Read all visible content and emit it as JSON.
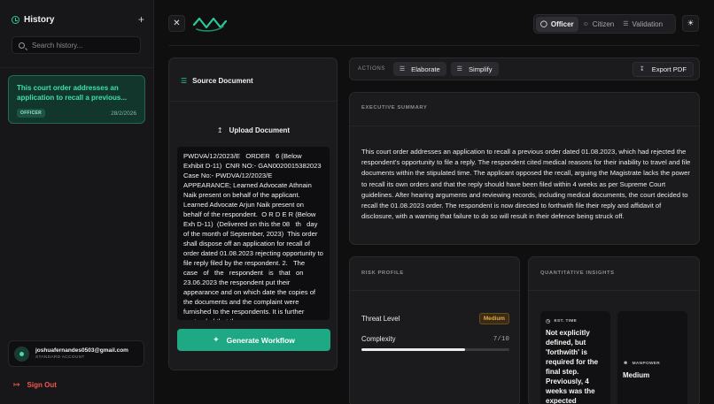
{
  "sidebar": {
    "title": "History",
    "new_icon": "plus-icon",
    "search_placeholder": "Search history...",
    "history_items": [
      {
        "text": "This court order addresses an application to recall a previous...",
        "badge": "OFFICER",
        "date": "28/2/2026"
      }
    ],
    "user": {
      "email": "joshuafernandes0503@gmail.com",
      "account_type": "STANDARD ACCOUNT"
    },
    "sign_out_label": "Sign Out"
  },
  "header": {
    "roles": [
      {
        "label": "Officer",
        "icon": "shield-icon",
        "active": true
      },
      {
        "label": "Citizen",
        "icon": "user-icon",
        "active": false
      },
      {
        "label": "Validation",
        "icon": "list-check-icon",
        "active": false
      }
    ]
  },
  "source": {
    "title": "Source Document",
    "upload_label": "Upload Document",
    "document_text": "PWDVA/12/2023/E   ORDER   6 (Below Exhibit D-11)  CNR NO:- GAN0020015382023  Case No:- PWDVA/12/2023/E  APPEARANCE; Learned Advocate Athnain Naik present on behalf of the applicant. Learned Advocate Arjun Naik present on behalf of the respondent.  O R D E R (Below Exh D-11)  (Delivered on this the 08   th   day of the month of September, 2023)  This order shall dispose off an application for recall of order dated 01.08.2023 rejecting opportunity to file reply filed by the respondent. 2.   The   case   of   the   respondent   is   that   on 23.06.2023 the respondent put their appearance and on which date the copies of the documents and the complaint were furnished to the respondents. It is further contended that the",
    "generate_label": "Generate Workflow"
  },
  "actions": {
    "label": "ACTIONS",
    "elaborate_label": "Elaborate",
    "simplify_label": "Simplify",
    "export_label": "Export PDF"
  },
  "summary": {
    "label": "EXECUTIVE SUMMARY",
    "text": "This court order addresses an application to recall a previous order dated 01.08.2023, which had rejected the respondent's opportunity to file a reply. The respondent cited medical reasons for their inability to travel and file documents within the stipulated time. The applicant opposed the recall, arguing the Magistrate lacks the power to recall its own orders and that the reply should have been filed within 4 weeks as per Supreme Court guidelines. After hearing arguments and reviewing records, including medical documents, the court decided to recall the 01.08.2023 order. The respondent is now directed to forthwith file their reply and affidavit of disclosure, with a warning that failure to do so will result in their defence being struck off."
  },
  "risk": {
    "label": "RISK PROFILE",
    "threat_label": "Threat Level",
    "threat_value": "Medium",
    "complexity_label": "Complexity",
    "complexity_value": "7/10",
    "complexity_fraction": 0.7
  },
  "quant": {
    "label": "QUANTITATIVE INSIGHTS",
    "time_label": "EST. TIME",
    "time_value": "Not explicitly defined, but 'forthwith' is required for the final step. Previously, 4 weeks was the expected",
    "manpower_label": "MANPOWER",
    "manpower_value": "Medium"
  },
  "colors": {
    "accent": "#2ec79a",
    "danger": "#f1584d",
    "warning": "#e0a64a"
  }
}
